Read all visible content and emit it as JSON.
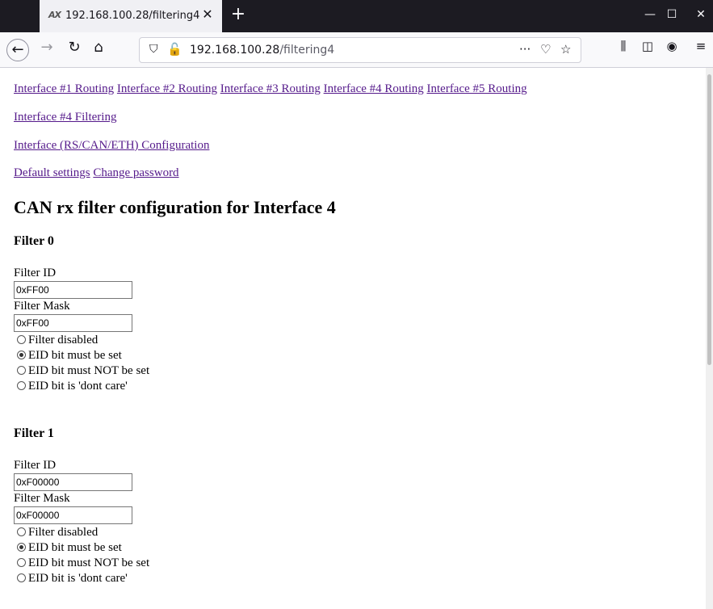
{
  "browser": {
    "tab_title": "192.168.100.28/filtering4",
    "tab_icon_text": "AX",
    "url_host": "192.168.100.28",
    "url_path": "/filtering4"
  },
  "nav": {
    "routing_links": [
      "Interface #1 Routing",
      "Interface #2 Routing",
      "Interface #3 Routing",
      "Interface #4 Routing",
      "Interface #5 Routing"
    ],
    "filtering_link": "Interface #4 Filtering",
    "config_link": "Interface (RS/CAN/ETH) Configuration",
    "default_settings_link": "Default settings",
    "change_password_link": "Change password"
  },
  "page": {
    "title": "CAN rx filter configuration for Interface 4"
  },
  "filters": [
    {
      "heading": "Filter 0",
      "id_label": "Filter ID",
      "id_value": "0xFF00",
      "mask_label": "Filter Mask",
      "mask_value": "0xFF00",
      "options": [
        "Filter disabled",
        "EID bit must be set",
        "EID bit must NOT be set",
        "EID bit is 'dont care'"
      ],
      "selected": 1
    },
    {
      "heading": "Filter 1",
      "id_label": "Filter ID",
      "id_value": "0xF00000",
      "mask_label": "Filter Mask",
      "mask_value": "0xF00000",
      "options": [
        "Filter disabled",
        "EID bit must be set",
        "EID bit must NOT be set",
        "EID bit is 'dont care'"
      ],
      "selected": 1
    }
  ]
}
